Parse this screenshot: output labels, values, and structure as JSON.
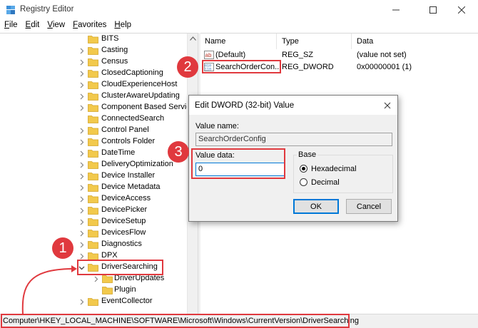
{
  "window": {
    "title": "Registry Editor",
    "minimize_glyph": "—",
    "close_glyph": "✕"
  },
  "menu": [
    {
      "label": "File",
      "u": "F",
      "rest": "ile"
    },
    {
      "label": "Edit",
      "u": "E",
      "rest": "dit"
    },
    {
      "label": "View",
      "u": "V",
      "rest": "iew"
    },
    {
      "label": "Favorites",
      "u": "F",
      "rest": "avorites"
    },
    {
      "label": "Help",
      "u": "H",
      "rest": "elp"
    }
  ],
  "tree": {
    "items": [
      {
        "label": "BITS",
        "chevron": "none"
      },
      {
        "label": "Casting",
        "chevron": "right"
      },
      {
        "label": "Census",
        "chevron": "right"
      },
      {
        "label": "ClosedCaptioning",
        "chevron": "right"
      },
      {
        "label": "CloudExperienceHost",
        "chevron": "right"
      },
      {
        "label": "ClusterAwareUpdating",
        "chevron": "right"
      },
      {
        "label": "Component Based Servic",
        "chevron": "right"
      },
      {
        "label": "ConnectedSearch",
        "chevron": "none"
      },
      {
        "label": "Control Panel",
        "chevron": "right"
      },
      {
        "label": "Controls Folder",
        "chevron": "right"
      },
      {
        "label": "DateTime",
        "chevron": "right"
      },
      {
        "label": "DeliveryOptimization",
        "chevron": "right"
      },
      {
        "label": "Device Installer",
        "chevron": "right"
      },
      {
        "label": "Device Metadata",
        "chevron": "right"
      },
      {
        "label": "DeviceAccess",
        "chevron": "right"
      },
      {
        "label": "DevicePicker",
        "chevron": "right"
      },
      {
        "label": "DeviceSetup",
        "chevron": "right"
      },
      {
        "label": "DevicesFlow",
        "chevron": "right"
      },
      {
        "label": "Diagnostics",
        "chevron": "right"
      },
      {
        "label": "DPX",
        "chevron": "right"
      },
      {
        "label": "DriverSearching",
        "chevron": "down"
      },
      {
        "label": "DriverUpdates",
        "chevron": "right"
      },
      {
        "label": "Plugin",
        "chevron": "none"
      },
      {
        "label": "EventCollector",
        "chevron": "right"
      }
    ]
  },
  "list": {
    "headers": {
      "name": "Name",
      "type": "Type",
      "data": "Data"
    },
    "rows": [
      {
        "icon": "string-value-icon",
        "name": "(Default)",
        "type": "REG_SZ",
        "data": "(value not set)"
      },
      {
        "icon": "binary-value-icon",
        "name": "SearchOrderCon...",
        "type": "REG_DWORD",
        "data": "0x00000001 (1)"
      }
    ]
  },
  "status": {
    "path": "Computer\\HKEY_LOCAL_MACHINE\\SOFTWARE\\Microsoft\\Windows\\CurrentVersion\\DriverSearching"
  },
  "dialog": {
    "title": "Edit DWORD (32-bit) Value",
    "close_glyph": "✕",
    "value_name_label": "Value name:",
    "value_name": "SearchOrderConfig",
    "value_data_label": "Value data:",
    "value_data": "0",
    "base_label": "Base",
    "radio_hex": "Hexadecimal",
    "radio_dec": "Decimal",
    "selected_base": "Hexadecimal",
    "ok_label": "OK",
    "cancel_label": "Cancel"
  },
  "annotations": {
    "step1": "1",
    "step2": "2",
    "step3": "3",
    "color": "#e0393e"
  },
  "colors": {
    "folder": "#f2c94c",
    "accent": "#0078d7"
  }
}
